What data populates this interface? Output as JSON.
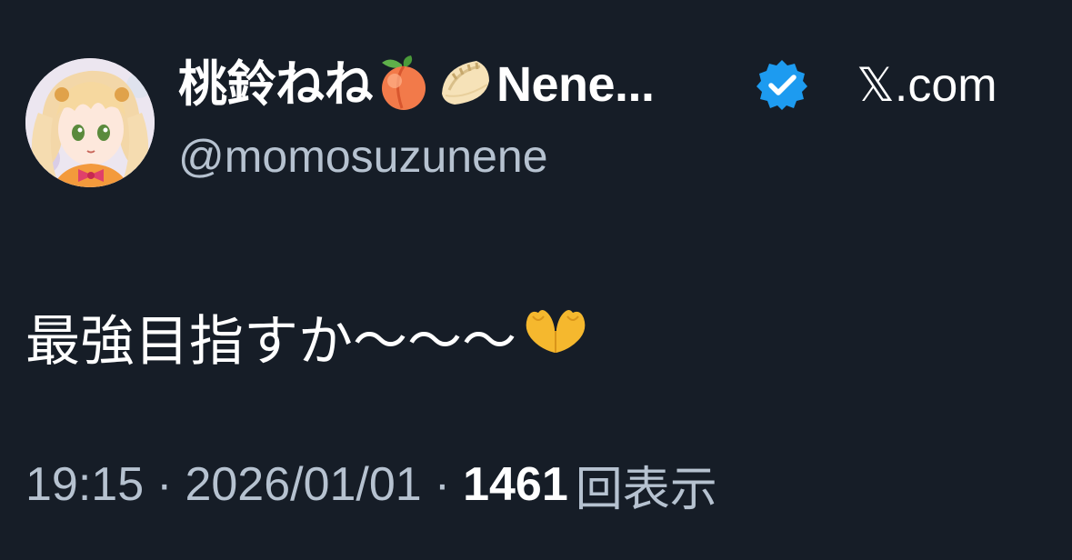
{
  "author": {
    "display_name": "桃鈴ねね",
    "display_name_suffix": "Nene...",
    "emojis": [
      "peach-emoji",
      "dumpling-emoji"
    ],
    "handle": "@momosuzunene",
    "verified": true,
    "verified_color": "#1d9bf0"
  },
  "source": {
    "site_label": "𝕏.com"
  },
  "tweet": {
    "text": "最強目指すか〜〜〜",
    "trailing_emoji": "heart-hands-emoji"
  },
  "meta": {
    "time": "19:15",
    "separator": "·",
    "date": "2026/01/01",
    "views_count": "1461",
    "views_label": "回表示"
  },
  "colors": {
    "background": "#161d27",
    "primary_text": "#ffffff",
    "secondary_text": "#b6c2d0"
  }
}
